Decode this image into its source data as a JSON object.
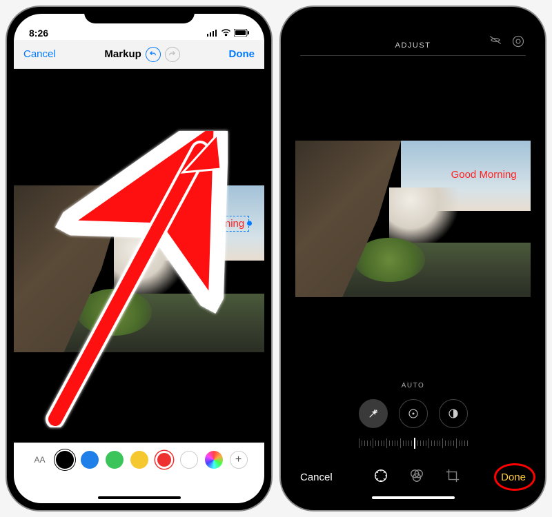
{
  "left": {
    "status_time": "8:26",
    "nav_cancel": "Cancel",
    "nav_title": "Markup",
    "nav_done": "Done",
    "text_annotation": "Good Morning",
    "font_btn": "AA",
    "swatches": [
      {
        "name": "black",
        "color": "#000000",
        "selected": true
      },
      {
        "name": "blue",
        "color": "#1e7fe8",
        "selected": false
      },
      {
        "name": "green",
        "color": "#3ac45a",
        "selected": false
      },
      {
        "name": "yellow",
        "color": "#f4c82e",
        "selected": false
      },
      {
        "name": "red",
        "color": "#ee3030",
        "selected": false
      },
      {
        "name": "white",
        "color": "#ffffff",
        "selected": false
      },
      {
        "name": "rainbow",
        "color": "conic",
        "selected": false
      }
    ]
  },
  "right": {
    "top_title": "ADJUST",
    "text_annotation": "Good Morning",
    "auto_label": "AUTO",
    "btn_cancel": "Cancel",
    "btn_done": "Done"
  }
}
